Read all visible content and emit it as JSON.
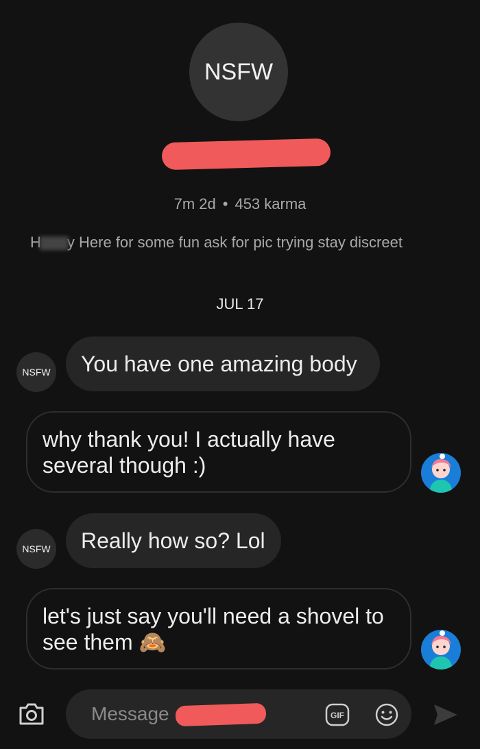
{
  "profile": {
    "avatar_text": "NSFW",
    "age": "7m 2d",
    "separator": "•",
    "karma": "453 karma",
    "bio_prefix": "H",
    "bio_suffix": "y Here for some fun ask for pic trying stay discreet"
  },
  "conversation": {
    "date_divider": "JUL 17",
    "messages": [
      {
        "sender": "other",
        "avatar_text": "NSFW",
        "text": "You have one amazing body"
      },
      {
        "sender": "me",
        "line1": "why thank you! I actually have",
        "line2": "several though :)"
      },
      {
        "sender": "other",
        "avatar_text": "NSFW",
        "text": "Really how so? Lol"
      },
      {
        "sender": "me",
        "line1": "let's just say you'll need a shovel to",
        "line2": "see them 🙈"
      }
    ]
  },
  "composer": {
    "placeholder": "Message",
    "gif_label": "GIF",
    "icons": [
      "camera-icon",
      "gif-icon",
      "emoji-icon",
      "send-icon"
    ]
  },
  "colors": {
    "background": "#121212",
    "bubble_incoming": "#262626",
    "redaction": "#f05a5a",
    "user_avatar": "#1a7ed8"
  }
}
